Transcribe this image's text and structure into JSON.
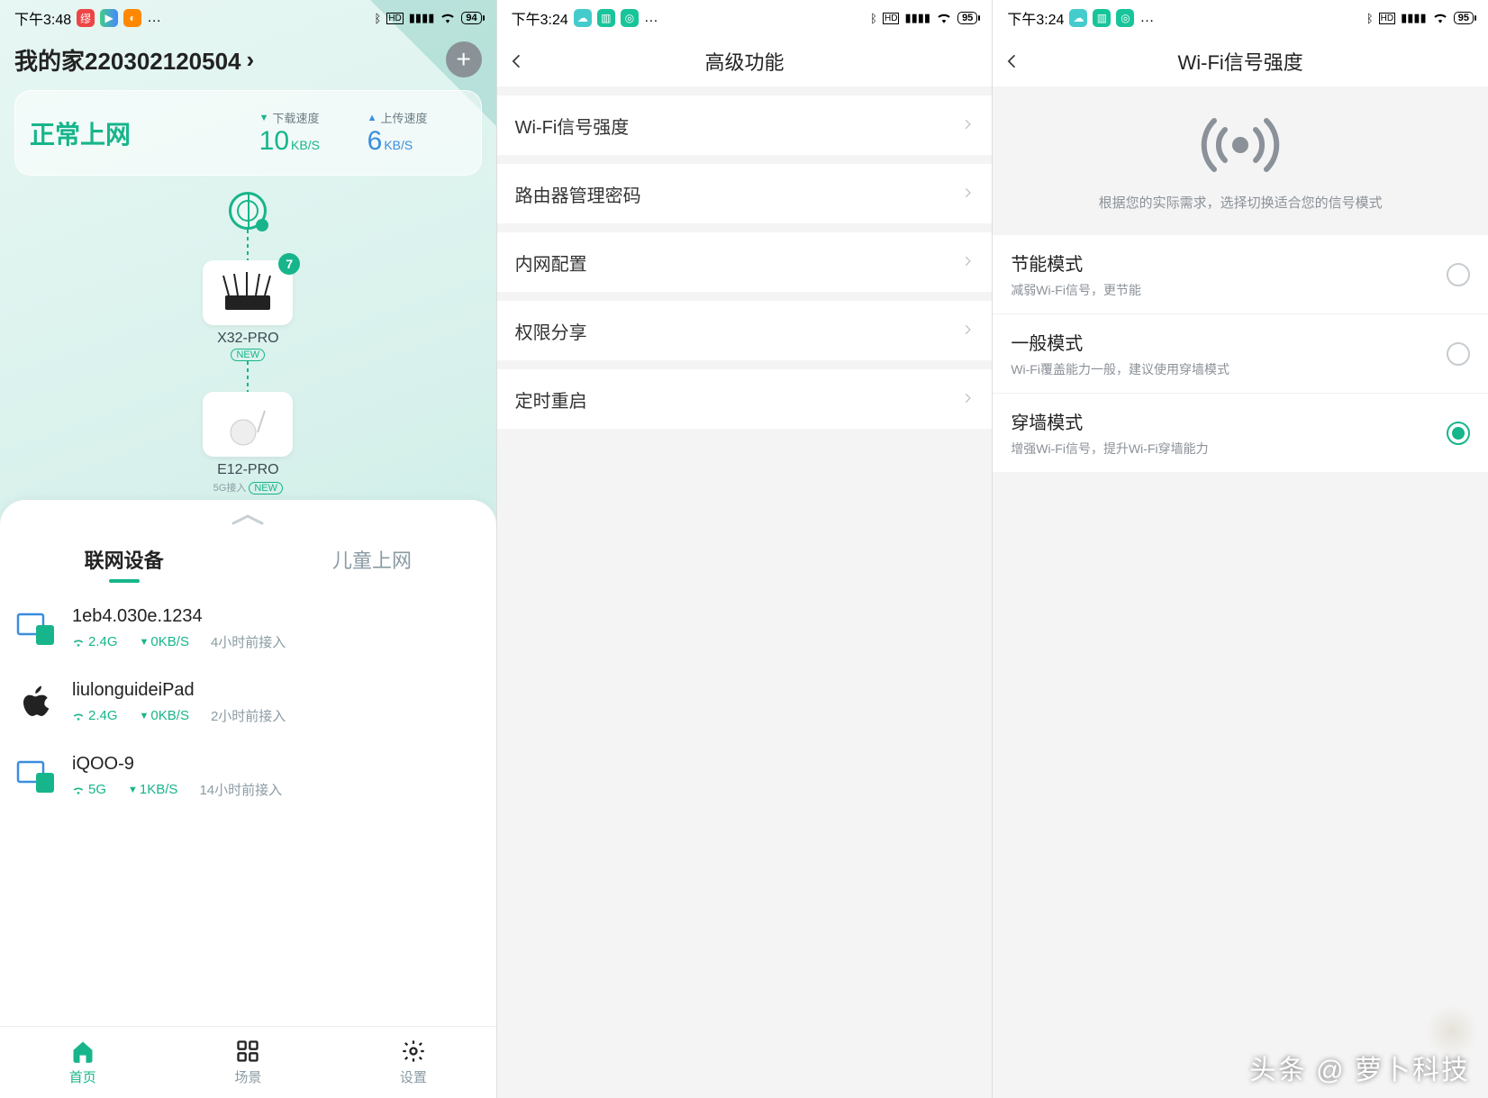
{
  "panel1": {
    "statusbar": {
      "time": "下午3:48",
      "battery": "94"
    },
    "title": "我的家220302120504",
    "netcard": {
      "status": "正常上网",
      "download_label": "下载速度",
      "download_value": "10",
      "download_unit": "KB/S",
      "upload_label": "上传速度",
      "upload_value": "6",
      "upload_unit": "KB/S"
    },
    "topo": {
      "node1": {
        "name": "X32-PRO",
        "tag": "NEW",
        "badge": "7"
      },
      "node2": {
        "name": "E12-PRO",
        "sub": "5G接入",
        "tag": "NEW"
      }
    },
    "tabs": {
      "active": "联网设备",
      "other": "儿童上网"
    },
    "devices": [
      {
        "name": "1eb4.030e.1234",
        "band": "2.4G",
        "speed": "0KB/S",
        "time": "4小时前接入",
        "icon": "pc"
      },
      {
        "name": "liulonguideiPad",
        "band": "2.4G",
        "speed": "0KB/S",
        "time": "2小时前接入",
        "icon": "apple"
      },
      {
        "name": "iQOO-9",
        "band": "5G",
        "speed": "1KB/S",
        "time": "14小时前接入",
        "icon": "pc"
      }
    ],
    "nav": {
      "home": "首页",
      "scene": "场景",
      "settings": "设置"
    }
  },
  "panel2": {
    "statusbar": {
      "time": "下午3:24",
      "battery": "95"
    },
    "title": "高级功能",
    "rows": [
      "Wi-Fi信号强度",
      "路由器管理密码",
      "内网配置",
      "权限分享",
      "定时重启"
    ]
  },
  "panel3": {
    "statusbar": {
      "time": "下午3:24",
      "battery": "95"
    },
    "title": "Wi-Fi信号强度",
    "caption": "根据您的实际需求，选择切换适合您的信号模式",
    "options": [
      {
        "title": "节能模式",
        "desc": "减弱Wi-Fi信号，更节能",
        "selected": false
      },
      {
        "title": "一般模式",
        "desc": "Wi-Fi覆盖能力一般，建议使用穿墙模式",
        "selected": false
      },
      {
        "title": "穿墙模式",
        "desc": "增强Wi-Fi信号，提升Wi-Fi穿墙能力",
        "selected": true
      }
    ]
  },
  "watermark": "头条 @ 萝卜科技"
}
